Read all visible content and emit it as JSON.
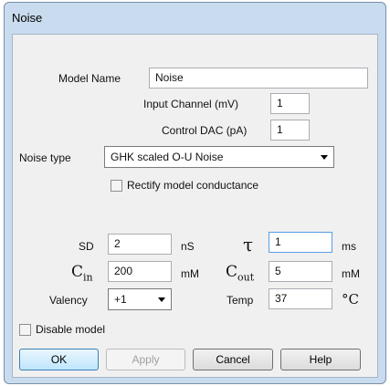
{
  "window": {
    "title": "Noise"
  },
  "fields": {
    "model_name": {
      "label": "Model Name",
      "value": "Noise"
    },
    "input_channel": {
      "label": "Input Channel (mV)",
      "value": "1"
    },
    "control_dac": {
      "label": "Control DAC (pA)",
      "value": "1"
    }
  },
  "noise_type": {
    "label": "Noise type",
    "selected": "GHK scaled O-U Noise"
  },
  "rectify": {
    "label": "Rectify model conductance",
    "checked": false
  },
  "params": {
    "sd": {
      "label": "SD",
      "value": "2",
      "unit": "nS"
    },
    "tau": {
      "symbol": "τ",
      "value": "1",
      "unit": "ms"
    },
    "cin": {
      "symbol": "C",
      "subscript": "in",
      "value": "200",
      "unit": "mM"
    },
    "cout": {
      "symbol": "C",
      "subscript": "out",
      "value": "5",
      "unit": "mM"
    },
    "valency": {
      "label": "Valency",
      "selected": "+1"
    },
    "temp": {
      "label": "Temp",
      "value": "37",
      "unit": "°C"
    }
  },
  "disable_model": {
    "label": "Disable model",
    "checked": false
  },
  "buttons": {
    "ok": "OK",
    "apply": "Apply",
    "cancel": "Cancel",
    "help": "Help"
  },
  "colors": {
    "frame": "#c9dbee",
    "client": "#f0f0f0",
    "focus_border": "#569de5",
    "default_button": "#3c7fb1"
  }
}
